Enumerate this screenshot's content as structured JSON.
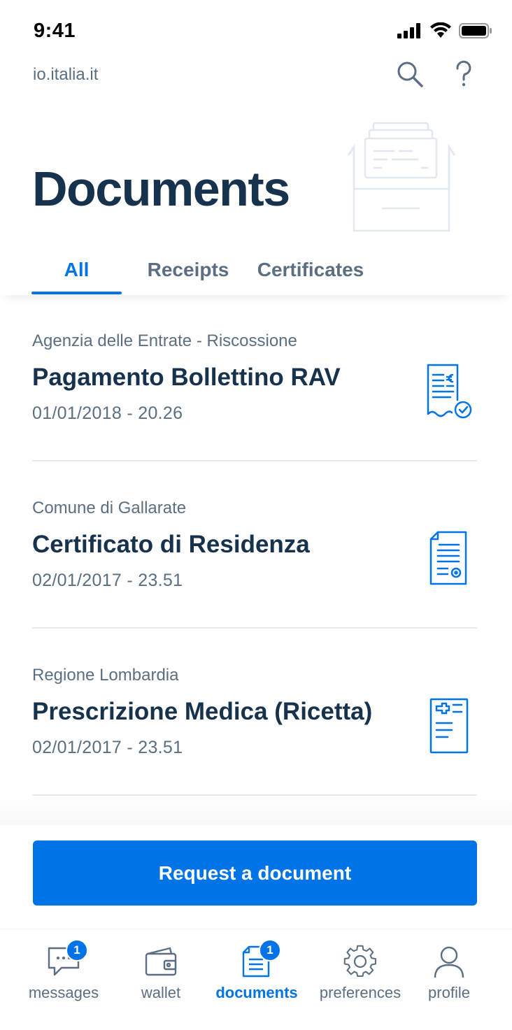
{
  "status_bar": {
    "time": "9:41"
  },
  "header": {
    "url": "io.italia.it",
    "search_icon": "search-icon",
    "help_icon": "question-mark-icon"
  },
  "page": {
    "title": "Documents"
  },
  "tabs": [
    {
      "label": "All",
      "active": true
    },
    {
      "label": "Receipts",
      "active": false
    },
    {
      "label": "Certificates",
      "active": false
    }
  ],
  "documents": [
    {
      "source": "Agenzia delle Entrate - Riscossione",
      "title": "Pagamento Bollettino RAV",
      "date": "01/01/2018 - 20.26",
      "icon": "receipt-check-icon"
    },
    {
      "source": "Comune di Gallarate",
      "title": "Certificato di Residenza",
      "date": "02/01/2017 - 23.51",
      "icon": "certificate-icon"
    },
    {
      "source": "Regione Lombardia",
      "title": "Prescrizione Medica (Ricetta)",
      "date": "02/01/2017 - 23.51",
      "icon": "medical-prescription-icon"
    }
  ],
  "actions": {
    "request_document": "Request a document"
  },
  "bottom_nav": [
    {
      "label": "messages",
      "icon": "message-icon",
      "badge": "1",
      "active": false
    },
    {
      "label": "wallet",
      "icon": "wallet-icon",
      "badge": "",
      "active": false
    },
    {
      "label": "documents",
      "icon": "document-icon",
      "badge": "1",
      "active": true
    },
    {
      "label": "preferences",
      "icon": "gear-icon",
      "badge": "",
      "active": false
    },
    {
      "label": "profile",
      "icon": "user-icon",
      "badge": "",
      "active": false
    }
  ],
  "colors": {
    "accent": "#0073e6",
    "title": "#17324d",
    "muted": "#5c6f82",
    "divider": "#e6e9f2"
  }
}
